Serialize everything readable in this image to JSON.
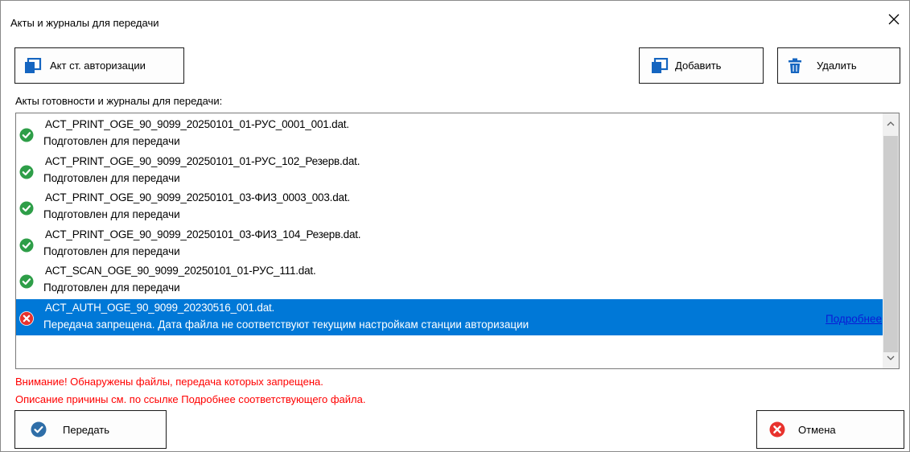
{
  "window": {
    "title": "Акты и журналы для передачи",
    "close_icon": "close-icon"
  },
  "toolbar": {
    "auth_act_label": "Акт ст. авторизации",
    "add_label": "Добавить",
    "delete_label": "Удалить"
  },
  "list_label": "Акты готовности и журналы для передачи:",
  "files": [
    {
      "name": "ACT_PRINT_OGE_90_9099_20250101_01-РУС_0001_001.dat.",
      "status": "Подготовлен для передачи",
      "state": "ok"
    },
    {
      "name": "ACT_PRINT_OGE_90_9099_20250101_01-РУС_102_Резерв.dat.",
      "status": "Подготовлен для передачи",
      "state": "ok"
    },
    {
      "name": "ACT_PRINT_OGE_90_9099_20250101_03-ФИЗ_0003_003.dat.",
      "status": "Подготовлен для передачи",
      "state": "ok"
    },
    {
      "name": "ACT_PRINT_OGE_90_9099_20250101_03-ФИЗ_104_Резерв.dat.",
      "status": "Подготовлен для передачи",
      "state": "ok"
    },
    {
      "name": "ACT_SCAN_OGE_90_9099_20250101_01-РУС_111.dat.",
      "status": "Подготовлен для передачи",
      "state": "ok"
    },
    {
      "name": "ACT_AUTH_OGE_90_9099_20230516_001.dat.",
      "status": "Передача запрещена. Дата файла не соответствуют текущим настройкам станции авторизации",
      "state": "error",
      "link": "Подробнее"
    }
  ],
  "warning": {
    "line1": "Внимание! Обнаружены файлы, передача которых запрещена.",
    "line2": "Описание причины см. по ссылке Подробнее соответствующего файла."
  },
  "footer": {
    "send_label": "Передать",
    "cancel_label": "Отмена"
  },
  "colors": {
    "ok": "#2e9e48",
    "error": "#e8322d",
    "selection": "#0078d7",
    "link": "#0a1bd6",
    "warning": "#ff0000",
    "accent_icon": "#1565c0"
  }
}
